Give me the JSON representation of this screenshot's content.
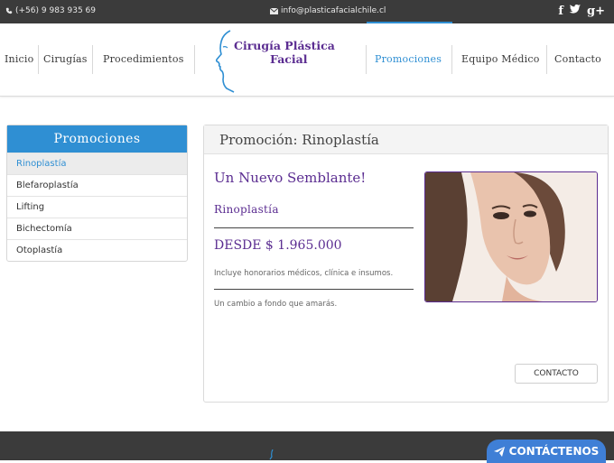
{
  "topbar": {
    "phone": "(+56) 9 983 935 69",
    "email": "info@plasticafacialchile.cl",
    "social": [
      {
        "icon": "facebook-icon",
        "glyph": "f"
      },
      {
        "icon": "twitter-icon",
        "glyph": "t"
      },
      {
        "icon": "google-plus-icon",
        "glyph": "g+"
      }
    ]
  },
  "nav": {
    "left": [
      "Inicio",
      "Cirugías",
      "Procedimientos"
    ],
    "right": [
      "Promociones",
      "Equipo Médico",
      "Contacto"
    ],
    "active": "Promociones"
  },
  "logo": {
    "line1": "Cirugía Plástica",
    "line2": "Facial"
  },
  "sidebar": {
    "title": "Promociones",
    "items": [
      "Rinoplastía",
      "Blefaroplastía",
      "Lifting",
      "Bichectomía",
      "Otoplastía"
    ],
    "active": "Rinoplastía"
  },
  "promo": {
    "title": "Promoción: Rinoplastía",
    "headline": "Un Nuevo Semblante!",
    "procedure": "Rinoplastía",
    "price": "DESDE $ 1.965.000",
    "includes": "Incluye honorarios médicos, clínica e insumos.",
    "tagline": "Un cambio a fondo que amarás.",
    "button": "CONTACTO"
  },
  "footer": {
    "cta": "CONTÁCTENOS"
  },
  "colors": {
    "accent_blue": "#2f8fd3",
    "brand_purple": "#5b2d91",
    "topbar_bg": "#3b3b3b",
    "cta_blue": "#3f7fd6"
  }
}
